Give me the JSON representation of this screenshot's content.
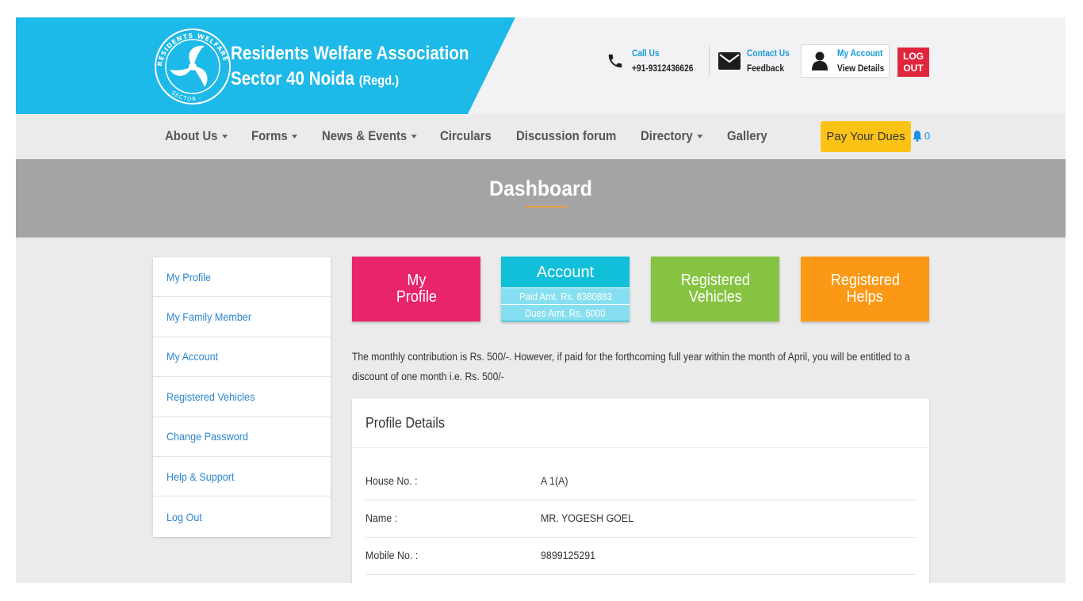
{
  "header": {
    "brand_line1": "Residents Welfare Association",
    "brand_line2": "Sector 40 Noida",
    "brand_suffix": "(Regd.)",
    "logo_text_top": "RESIDENTS WELFARE ASSOCIATION",
    "logo_text_bottom": "SECTOR - 40",
    "call": {
      "title": "Call Us",
      "value": "+91-9312436626",
      "icon": "phone-icon"
    },
    "contact": {
      "title": "Contact Us",
      "value": "Feedback",
      "icon": "envelope-icon"
    },
    "account": {
      "title": "My Account",
      "value": "View Details",
      "icon": "user-icon"
    },
    "logout_line1": "LOG",
    "logout_line2": "OUT",
    "colors": {
      "brand_blue": "#1db9e8",
      "logout_red": "#e0263d"
    }
  },
  "nav": {
    "items": [
      {
        "label": "About Us",
        "dropdown": true
      },
      {
        "label": "Forms",
        "dropdown": true
      },
      {
        "label": "News & Events",
        "dropdown": true
      },
      {
        "label": "Circulars",
        "dropdown": false
      },
      {
        "label": "Discussion forum",
        "dropdown": false
      },
      {
        "label": "Directory",
        "dropdown": true
      },
      {
        "label": "Gallery",
        "dropdown": false
      }
    ],
    "pay_button": "Pay Your Dues",
    "notification_count": "0"
  },
  "page_title": "Dashboard",
  "sidebar": {
    "items": [
      "My Profile",
      "My Family Member",
      "My Account",
      "Registered Vehicles",
      "Change Password",
      "Help & Support",
      "Log Out"
    ]
  },
  "tiles": {
    "profile": {
      "line1": "My",
      "line2": "Profile",
      "color": "#e8246a"
    },
    "account": {
      "title": "Account",
      "paid": "Paid Amt. Rs. 8380883",
      "dues": "Dues Amt. Rs. 6000",
      "color": "#12bfd9"
    },
    "vehicles": {
      "line1": "Registered",
      "line2": "Vehicles",
      "color": "#86c342"
    },
    "helps": {
      "line1": "Registered",
      "line2": "Helps",
      "color": "#fb9815"
    }
  },
  "notice": "The monthly contribution is Rs. 500/-. However, if paid for the forthcoming full year within the month of April, you will be entitled to a discount of one month i.e. Rs. 500/-",
  "profile": {
    "title": "Profile Details",
    "rows": [
      {
        "label": "House No. :",
        "value": "A 1(A)"
      },
      {
        "label": "Name :",
        "value": "MR. YOGESH GOEL"
      },
      {
        "label": "Mobile No. :",
        "value": "9899125291"
      }
    ]
  }
}
